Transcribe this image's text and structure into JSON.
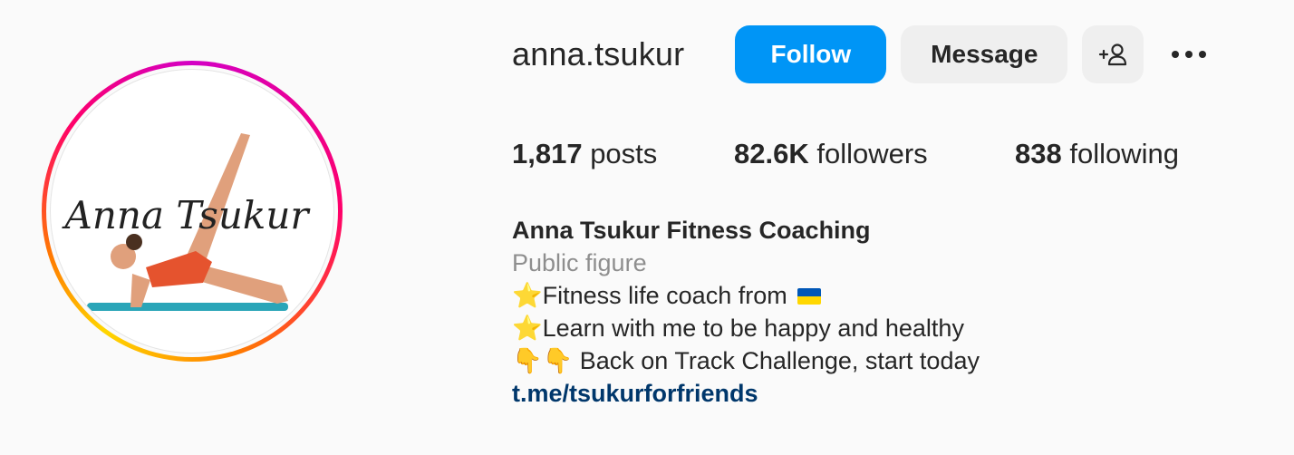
{
  "profile": {
    "username": "anna.tsukur",
    "avatar_text": "Anna Tsukur"
  },
  "actions": {
    "follow_label": "Follow",
    "message_label": "Message",
    "add_user_icon": "person-add-icon",
    "more_icon": "more-horizontal-icon"
  },
  "stats": {
    "posts_count": "1,817",
    "posts_label": " posts",
    "followers_count": "82.6K",
    "followers_label": " followers",
    "following_count": "838",
    "following_label": " following"
  },
  "bio": {
    "name": "Anna Tsukur Fitness Coaching",
    "category": "Public figure",
    "line1_emoji": "⭐",
    "line1_text": "Fitness life coach from",
    "line1_flag": "ukraine-flag-icon",
    "line2_emoji": "⭐",
    "line2_text": "Learn with me to be happy and healthy",
    "line3_emoji": "👇👇",
    "line3_text": " Back on Track Challenge, start today",
    "link": "t.me/tsukurforfriends"
  },
  "colors": {
    "accent": "#0095f6",
    "link": "#00376b",
    "secondary_text": "#8e8e8e",
    "button_bg": "#efefef",
    "flag_blue": "#0057b7",
    "flag_yellow": "#ffd700"
  }
}
